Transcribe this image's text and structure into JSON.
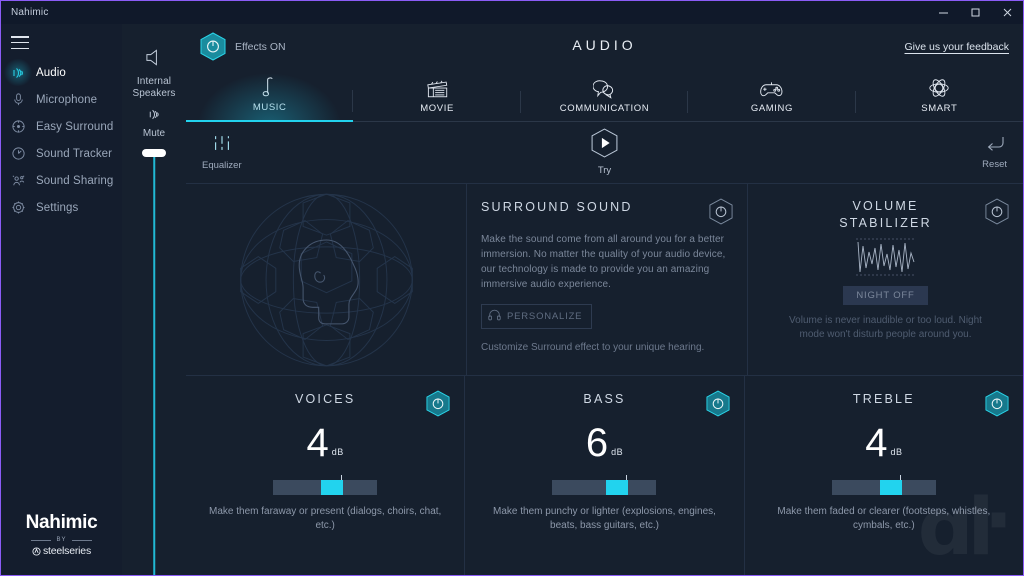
{
  "window": {
    "title": "Nahimic",
    "controls": {
      "minimize": "minimize-button",
      "maximize": "maximize-button",
      "close": "close-button"
    }
  },
  "sidebar": {
    "menu_icon": "hamburger-menu-icon",
    "items": [
      {
        "label": "Audio",
        "icon": "audio-waves-icon",
        "active": true
      },
      {
        "label": "Microphone",
        "icon": "microphone-icon",
        "active": false
      },
      {
        "label": "Easy Surround",
        "icon": "easy-surround-icon",
        "active": false
      },
      {
        "label": "Sound Tracker",
        "icon": "sound-tracker-icon",
        "active": false
      },
      {
        "label": "Sound Sharing",
        "icon": "sound-sharing-icon",
        "active": false
      },
      {
        "label": "Settings",
        "icon": "gear-icon",
        "active": false
      }
    ],
    "brand": {
      "name": "Nahimic",
      "by": "BY",
      "company": "steelseries"
    }
  },
  "device": {
    "speaker_icon": "speaker-icon",
    "name": "Internal Speakers",
    "mute_icon": "mute-icon",
    "mute_label": "Mute",
    "volume_value": 92
  },
  "header": {
    "effects_toggle_icon": "power-icon",
    "effects_label": "Effects ON",
    "title": "AUDIO",
    "feedback_link": "Give us your feedback"
  },
  "tabs": [
    {
      "label": "MUSIC",
      "icon": "music-note-icon",
      "active": true
    },
    {
      "label": "MOVIE",
      "icon": "clapperboard-icon",
      "active": false
    },
    {
      "label": "COMMUNICATION",
      "icon": "speech-bubbles-icon",
      "active": false
    },
    {
      "label": "GAMING",
      "icon": "gamepad-icon",
      "active": false
    },
    {
      "label": "SMART",
      "icon": "atom-icon",
      "active": false
    }
  ],
  "toolbar": {
    "equalizer_label": "Equalizer",
    "equalizer_icon": "equalizer-sliders-icon",
    "try_label": "Try",
    "try_icon": "play-icon",
    "reset_label": "Reset",
    "reset_icon": "reset-arrow-icon"
  },
  "panels": {
    "surround": {
      "title": "SURROUND SOUND",
      "description": "Make the sound come from all around you for a better immersion. No matter the quality of your audio device, our technology is made to provide you an amazing immersive audio experience.",
      "button_label": "PERSONALIZE",
      "button_icon": "headphones-icon",
      "note": "Customize Surround effect to your unique hearing.",
      "power_icon": "power-icon",
      "enabled": false,
      "visual": "surround-sphere-head-graphic"
    },
    "volume_stabilizer": {
      "title_line1": "VOLUME",
      "title_line2": "STABILIZER",
      "waveform_icon": "waveform-graphic",
      "button_label": "NIGHT OFF",
      "note": "Volume is never inaudible or too loud. Night mode won't disturb people around you.",
      "power_icon": "power-icon",
      "enabled": false
    },
    "effects": [
      {
        "title": "VOICES",
        "value": "4",
        "unit": "dB",
        "slider_percent": 57,
        "description": "Make them faraway or present (dialogs, choirs, chat, etc.)",
        "power_icon": "power-icon",
        "enabled": true
      },
      {
        "title": "BASS",
        "value": "6",
        "unit": "dB",
        "slider_percent": 62,
        "description": "Make them punchy or lighter (explosions, engines, beats, bass guitars, etc.)",
        "power_icon": "power-icon",
        "enabled": true
      },
      {
        "title": "TREBLE",
        "value": "4",
        "unit": "dB",
        "slider_percent": 57,
        "description": "Make them faded or clearer (footsteps, whistles, cymbals, etc.)",
        "power_icon": "power-icon",
        "enabled": true
      }
    ]
  },
  "colors": {
    "accent_cyan": "#22d3ee",
    "accent_teal": "#1a8c9e",
    "background": "#16202e",
    "sidebar_bg": "#141d2d",
    "window_border": "#8b5cf6"
  }
}
